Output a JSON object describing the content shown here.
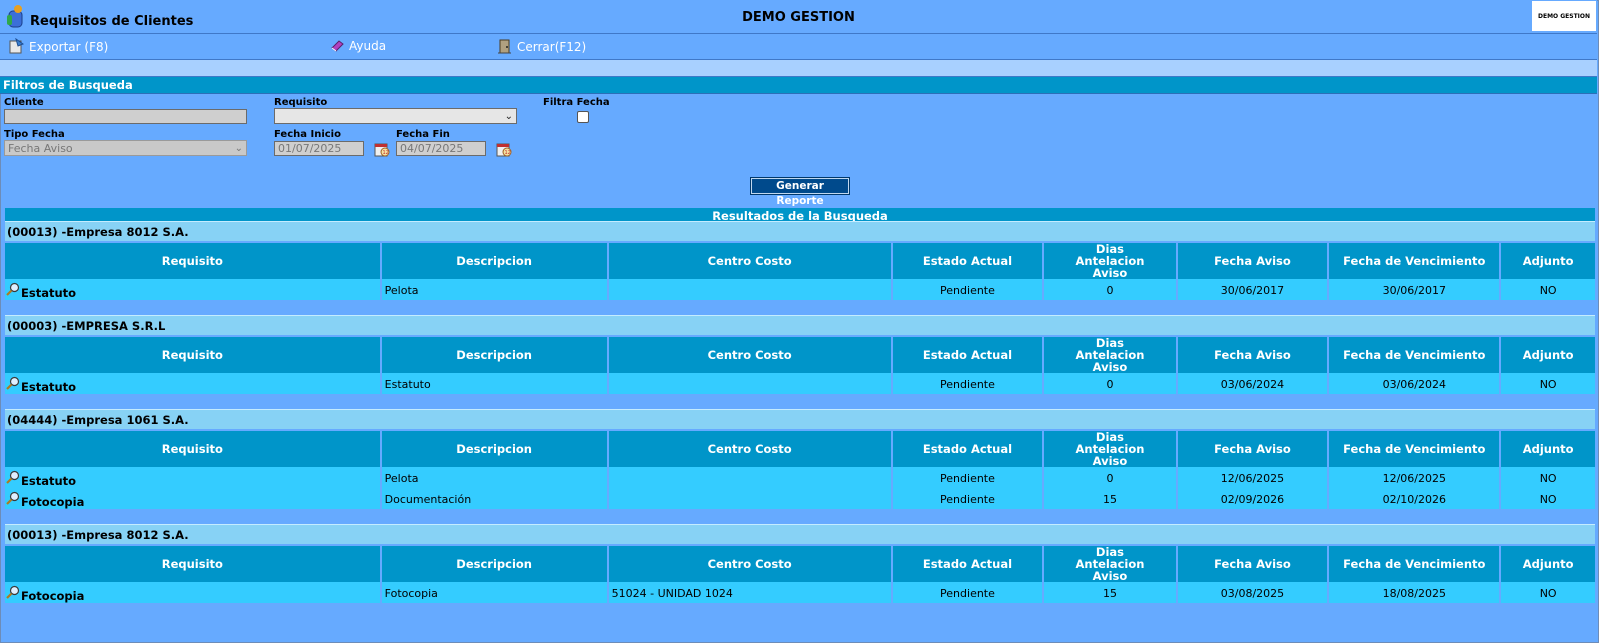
{
  "header": {
    "app_title": "Requisitos de Clientes",
    "company": "DEMO GESTION",
    "logo_text": "DEMO GESTION"
  },
  "toolbar": {
    "export_label": "Exportar (F8)",
    "help_label": "Ayuda",
    "close_label": "Cerrar(F12)"
  },
  "filters": {
    "title": "Filtros de Busqueda",
    "cliente_label": "Cliente",
    "cliente_value": "",
    "requisito_label": "Requisito",
    "requisito_value": "",
    "filtra_fecha_label": "Filtra Fecha",
    "tipo_fecha_label": "Tipo Fecha",
    "tipo_fecha_value": "Fecha Aviso",
    "fecha_inicio_label": "Fecha Inicio",
    "fecha_inicio_value": "01/07/2025",
    "fecha_fin_label": "Fecha Fin",
    "fecha_fin_value": "04/07/2025",
    "generate_label": "Generar Reporte"
  },
  "results": {
    "title": "Resultados de la Busqueda",
    "columns": [
      "Requisito",
      "Descripcion",
      "Centro Costo",
      "Estado Actual",
      "Dias Antelacion Aviso",
      "Fecha Aviso",
      "Fecha de Vencimiento",
      "Adjunto"
    ],
    "groups": [
      {
        "title": "(00013) -Empresa 8012 S.A.",
        "rows": [
          {
            "requisito": "Estatuto",
            "descripcion": "Pelota",
            "centro_costo": "",
            "estado": "Pendiente",
            "dias": "0",
            "fecha_aviso": "30/06/2017",
            "fecha_venc": "30/06/2017",
            "adjunto": "NO"
          }
        ]
      },
      {
        "title": "(00003) -EMPRESA S.R.L",
        "rows": [
          {
            "requisito": "Estatuto",
            "descripcion": "Estatuto",
            "centro_costo": "",
            "estado": "Pendiente",
            "dias": "0",
            "fecha_aviso": "03/06/2024",
            "fecha_venc": "03/06/2024",
            "adjunto": "NO"
          }
        ]
      },
      {
        "title": "(04444) -Empresa 1061 S.A.",
        "rows": [
          {
            "requisito": "Estatuto",
            "descripcion": "Pelota",
            "centro_costo": "",
            "estado": "Pendiente",
            "dias": "0",
            "fecha_aviso": "12/06/2025",
            "fecha_venc": "12/06/2025",
            "adjunto": "NO"
          },
          {
            "requisito": "Fotocopia",
            "descripcion": "Documentación",
            "centro_costo": "",
            "estado": "Pendiente",
            "dias": "15",
            "fecha_aviso": "02/09/2026",
            "fecha_venc": "02/10/2026",
            "adjunto": "NO"
          }
        ]
      },
      {
        "title": "(00013) -Empresa 8012 S.A.",
        "rows": [
          {
            "requisito": "Fotocopia",
            "descripcion": "Fotocopia",
            "centro_costo": "51024 - UNIDAD 1024",
            "estado": "Pendiente",
            "dias": "15",
            "fecha_aviso": "03/08/2025",
            "fecha_venc": "18/08/2025",
            "adjunto": "NO"
          }
        ]
      }
    ]
  }
}
